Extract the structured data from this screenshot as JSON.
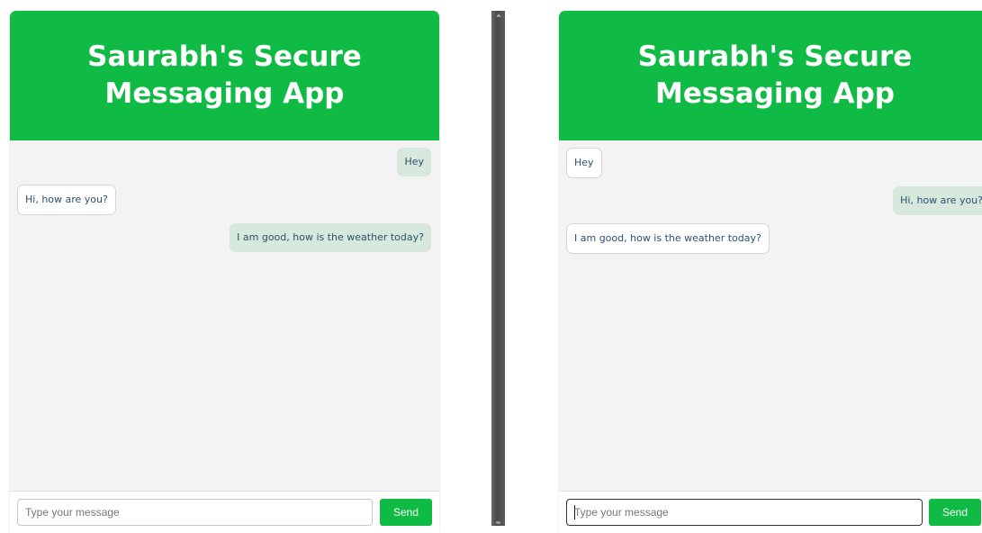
{
  "left_pane": {
    "title": "Saurabh's Secure Messaging App",
    "messages": [
      {
        "text": "Hey",
        "side": "sent"
      },
      {
        "text": "Hi, how are you?",
        "side": "received"
      },
      {
        "text": "I am good, how is the weather today?",
        "side": "sent"
      }
    ],
    "input_placeholder": "Type your message",
    "send_label": "Send"
  },
  "right_pane": {
    "title": "Saurabh's Secure Messaging App",
    "messages": [
      {
        "text": "Hey",
        "side": "received"
      },
      {
        "text": "Hi, how are you?",
        "side": "sent"
      },
      {
        "text": "I am good, how is the weather today?",
        "side": "received"
      }
    ],
    "input_placeholder": "Type your message",
    "send_label": "Send"
  },
  "colors": {
    "header": "#0fba45",
    "sent_bubble": "#d6e9dc",
    "received_bubble": "#ffffff"
  }
}
